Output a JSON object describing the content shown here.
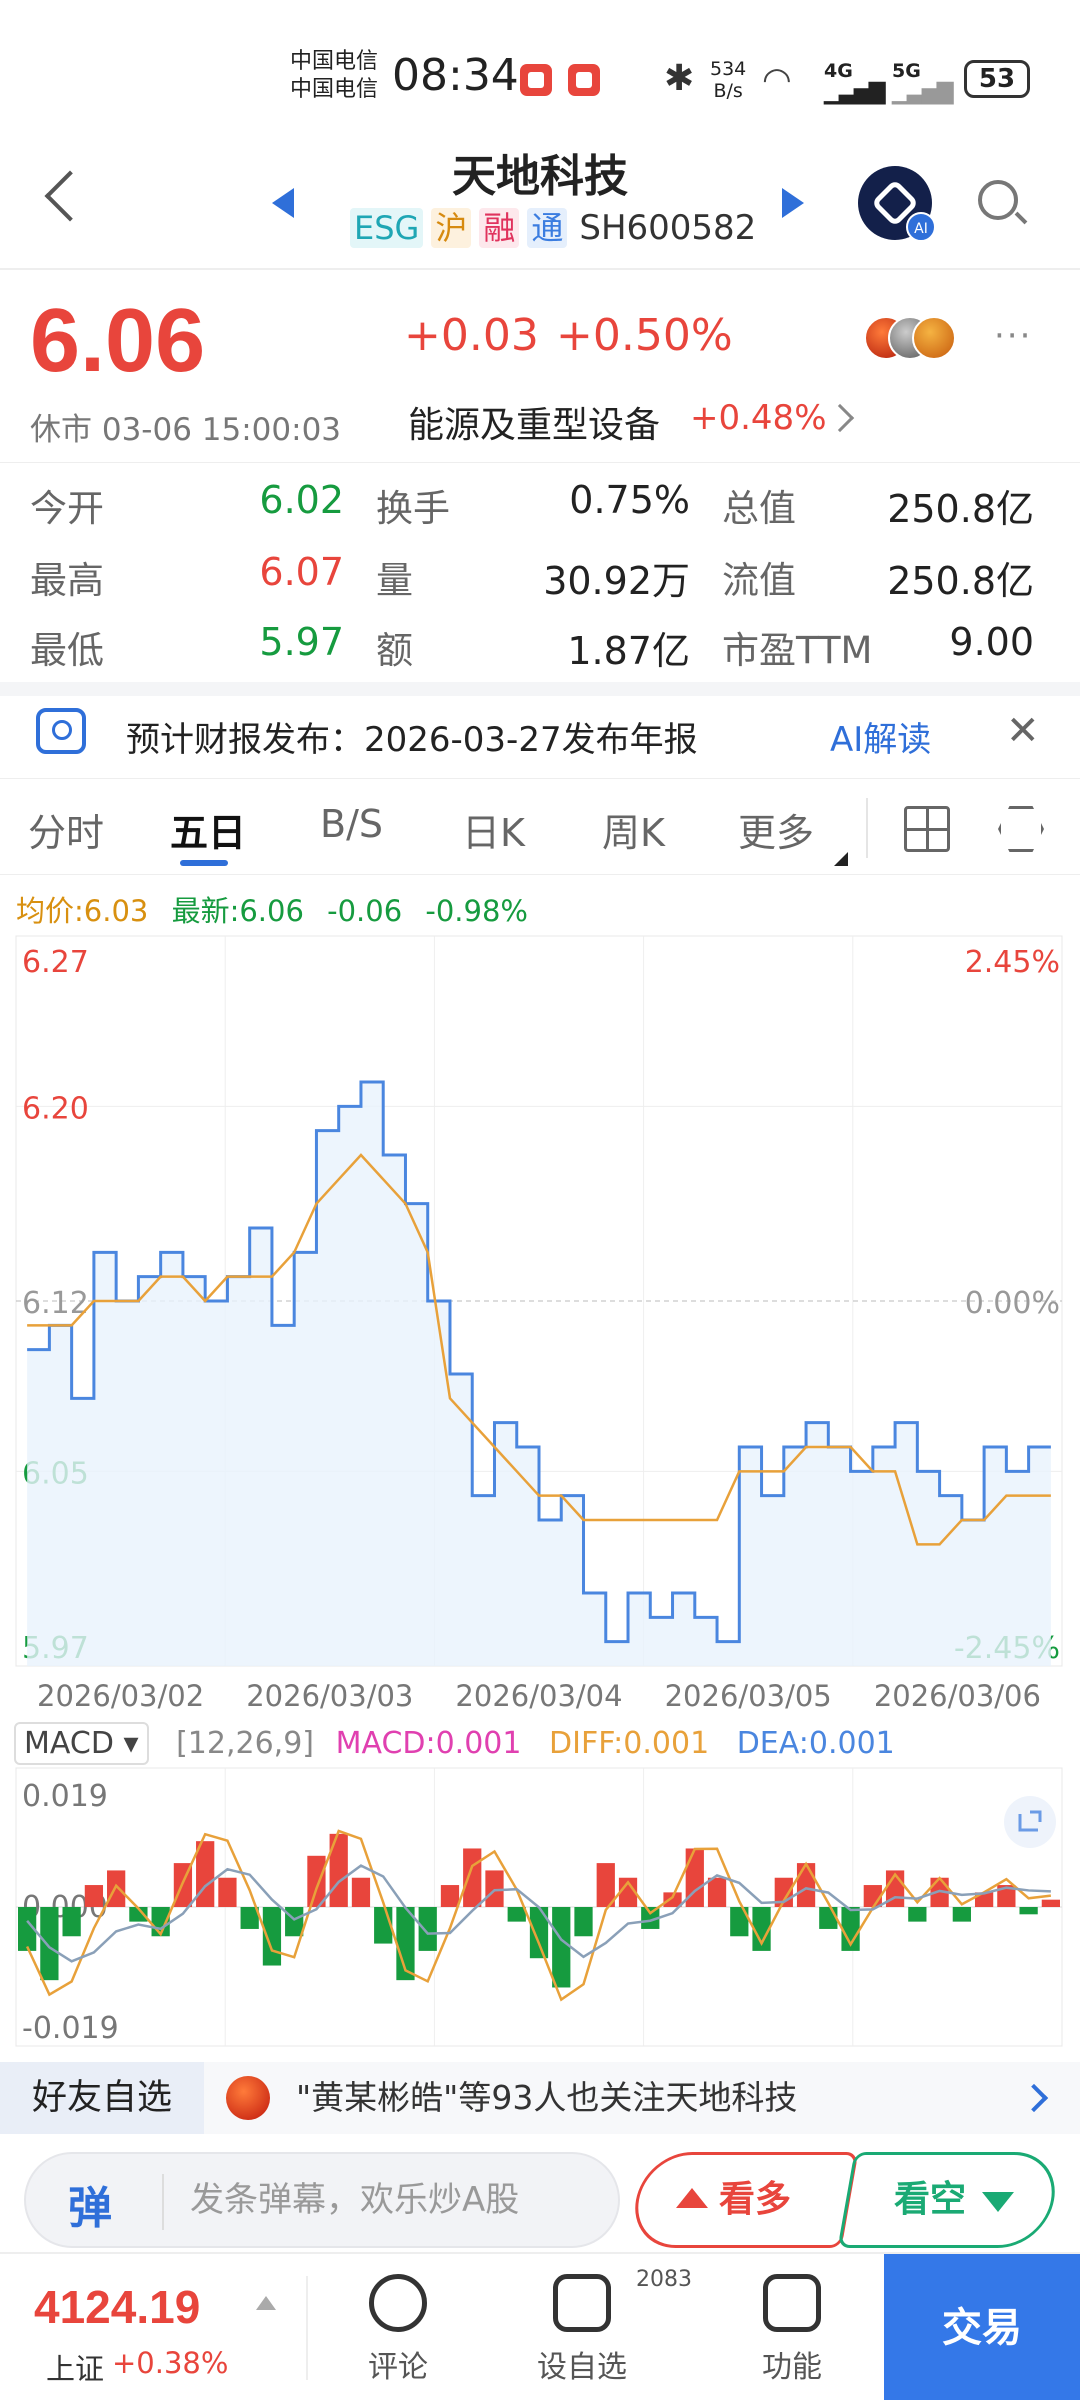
{
  "status_bar": {
    "carrier1": "中国电信",
    "carrier2": "中国电信",
    "time": "08:34",
    "net_speed_value": "534",
    "net_speed_unit": "B/s",
    "signal1": "4G",
    "signal2": "5G",
    "battery": "53"
  },
  "header": {
    "title": "天地科技",
    "tag_esg": "ESG",
    "tag_hu": "沪",
    "tag_rong": "融",
    "tag_tong": "通",
    "code": "SH600582",
    "ai_badge": "AI"
  },
  "quote": {
    "price": "6.06",
    "change": "+0.03",
    "change_pct": "+0.50%",
    "market_status": "休市 03-06 15:00:03",
    "sector": "能源及重型设备",
    "sector_pct": "+0.48%",
    "more": "···"
  },
  "stats": [
    {
      "label": "今开",
      "value": "6.02",
      "color": "#169b3f"
    },
    {
      "label": "换手",
      "value": "0.75%",
      "color": "#222222"
    },
    {
      "label": "总值",
      "value": "250.8亿",
      "color": "#222222"
    },
    {
      "label": "最高",
      "value": "6.07",
      "color": "#e8453c"
    },
    {
      "label": "量",
      "value": "30.92万",
      "color": "#222222"
    },
    {
      "label": "流值",
      "value": "250.8亿",
      "color": "#222222"
    },
    {
      "label": "最低",
      "value": "5.97",
      "color": "#169b3f"
    },
    {
      "label": "额",
      "value": "1.87亿",
      "color": "#222222"
    },
    {
      "label": "市盈TTM",
      "value": "9.00",
      "color": "#222222"
    }
  ],
  "notice": {
    "text": "预计财报发布：2026-03-27发布年报",
    "ai_link": "AI解读",
    "close": "✕"
  },
  "tabs": [
    "分时",
    "五日",
    "B/S",
    "日K",
    "周K",
    "更多"
  ],
  "active_tab": "五日",
  "chart_legend": {
    "avg": "均价:6.03",
    "latest": "最新:6.06",
    "chg": "-0.06",
    "pct": "-0.98%"
  },
  "chart_data": [
    {
      "type": "line",
      "title": "五日",
      "categories": [
        "2026/03/02",
        "2026/03/03",
        "2026/03/04",
        "2026/03/05",
        "2026/03/06"
      ],
      "ylim": [
        5.97,
        6.27
      ],
      "y_ticks_left": [
        "6.27",
        "6.20",
        "6.12",
        "6.05",
        "5.97"
      ],
      "y_ticks_right": [
        "2.45%",
        "0.00%",
        "-2.45%"
      ],
      "reference": 6.12,
      "series": [
        {
          "name": "价格",
          "color": "#4a86df",
          "values": [
            6.1,
            6.11,
            6.08,
            6.14,
            6.12,
            6.13,
            6.14,
            6.13,
            6.12,
            6.13,
            6.15,
            6.11,
            6.14,
            6.19,
            6.2,
            6.21,
            6.18,
            6.16,
            6.12,
            6.09,
            6.04,
            6.07,
            6.06,
            6.03,
            6.04,
            6.0,
            5.98,
            6.0,
            5.99,
            6.0,
            5.99,
            5.98,
            6.06,
            6.04,
            6.06,
            6.07,
            6.06,
            6.05,
            6.06,
            6.07,
            6.05,
            6.04,
            6.03,
            6.06,
            6.05,
            6.06,
            6.06
          ]
        },
        {
          "name": "均价",
          "color": "#e8a13a",
          "values": [
            6.11,
            6.11,
            6.11,
            6.12,
            6.12,
            6.12,
            6.13,
            6.13,
            6.12,
            6.13,
            6.13,
            6.13,
            6.14,
            6.16,
            6.17,
            6.18,
            6.17,
            6.16,
            6.14,
            6.08,
            6.07,
            6.06,
            6.05,
            6.04,
            6.04,
            6.03,
            6.03,
            6.03,
            6.03,
            6.03,
            6.03,
            6.03,
            6.05,
            6.05,
            6.05,
            6.06,
            6.06,
            6.06,
            6.05,
            6.05,
            6.02,
            6.02,
            6.03,
            6.03,
            6.04,
            6.04,
            6.04
          ]
        }
      ]
    },
    {
      "type": "bar",
      "title": "MACD",
      "params": "[12,26,9]",
      "ylim": [
        -0.019,
        0.019
      ],
      "y_ticks": [
        "0.019",
        "0.000",
        "-0.019"
      ],
      "macd_label": "MACD:0.001",
      "diff_label": "DIFF:0.001",
      "dea_label": "DEA:0.001",
      "values": [
        -0.006,
        -0.01,
        -0.004,
        0.003,
        0.005,
        -0.002,
        -0.004,
        0.006,
        0.009,
        0.004,
        -0.003,
        -0.008,
        -0.004,
        0.007,
        0.01,
        0.004,
        -0.005,
        -0.01,
        -0.006,
        0.003,
        0.008,
        0.005,
        -0.002,
        -0.007,
        -0.011,
        -0.004,
        0.006,
        0.004,
        -0.003,
        0.002,
        0.008,
        0.004,
        -0.004,
        -0.006,
        0.004,
        0.006,
        -0.003,
        -0.006,
        0.003,
        0.005,
        -0.002,
        0.004,
        -0.002,
        0.002,
        0.003,
        -0.001,
        0.001
      ]
    }
  ],
  "macd_selector": "MACD",
  "friends": {
    "label": "好友自选",
    "text": "\"黄某彬皓\"等93人也关注天地科技"
  },
  "barrage": {
    "icon": "弹",
    "placeholder": "发条弹幕，欢乐炒A股",
    "bull": "看多",
    "bear": "看空"
  },
  "bottom_nav": {
    "index_value": "4124.19",
    "index_name": "上证",
    "index_pct": "+0.38%",
    "comment": "评论",
    "watchlist": "设自选",
    "watch_count": "2083",
    "features": "功能",
    "trade": "交易"
  }
}
